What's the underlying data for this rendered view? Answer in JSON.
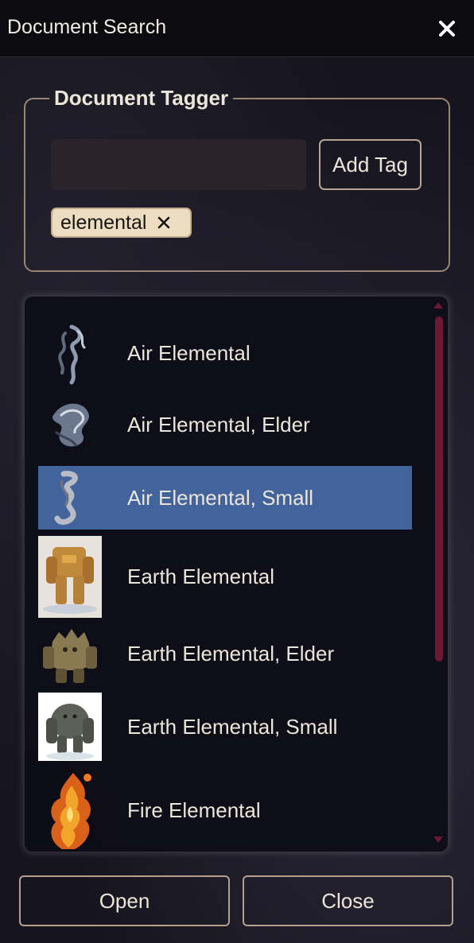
{
  "window": {
    "title": "Document Search",
    "close_icon": "close-icon"
  },
  "tagger": {
    "legend": "Document Tagger",
    "input_value": "",
    "add_tag_label": "Add Tag",
    "tags": [
      {
        "label": "elemental",
        "remove_icon": "close-icon"
      }
    ]
  },
  "results": {
    "selected_index": 2,
    "items": [
      {
        "label": "Air Elemental",
        "image": "air-elemental-token"
      },
      {
        "label": "Air Elemental, Elder",
        "image": "air-elemental-elder-token"
      },
      {
        "label": "Air Elemental, Small",
        "image": "air-elemental-small-token"
      },
      {
        "label": "Earth Elemental",
        "image": "earth-elemental-portrait"
      },
      {
        "label": "Earth Elemental, Elder",
        "image": "earth-elemental-elder-token"
      },
      {
        "label": "Earth Elemental, Small",
        "image": "earth-elemental-small-portrait"
      },
      {
        "label": "Fire Elemental",
        "image": "fire-elemental-token"
      }
    ]
  },
  "footer": {
    "open_label": "Open",
    "close_label": "Close"
  },
  "colors": {
    "selection": "#42639c",
    "scrollbar": "#6b1832",
    "chip": "#ecdcc0",
    "border": "#9a8474"
  }
}
